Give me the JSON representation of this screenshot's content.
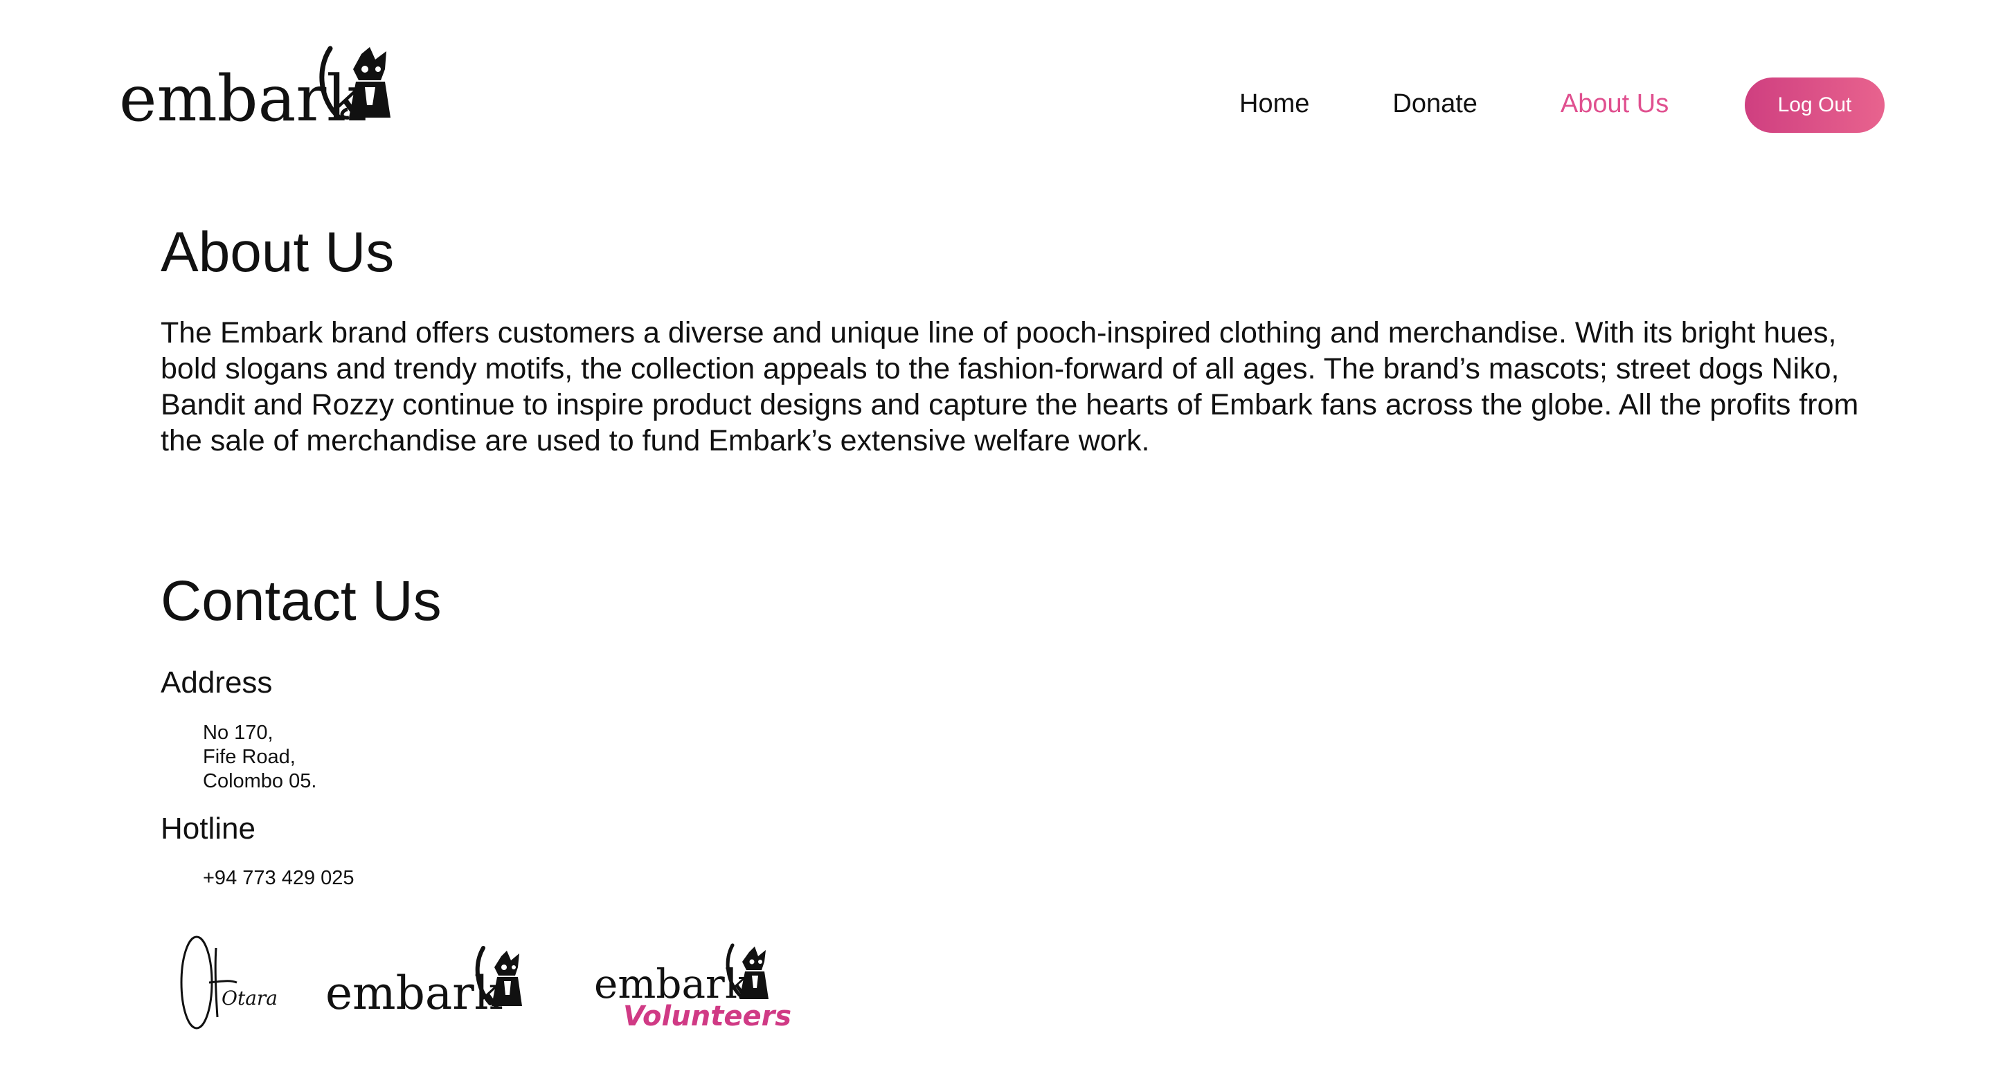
{
  "header": {
    "logo_text": "embark",
    "nav": [
      {
        "label": "Home",
        "active": false
      },
      {
        "label": "Donate",
        "active": false
      },
      {
        "label": "About Us",
        "active": true
      }
    ],
    "logout_label": "Log Out"
  },
  "about": {
    "title": "About Us",
    "text": "The Embark brand offers customers a diverse and unique line of pooch-inspired clothing and merchandise. With its bright hues, bold slogans and trendy motifs, the collection appeals to the fashion-forward of all ages. The brand’s mascots; street dogs Niko, Bandit and Rozzy continue to inspire product designs and capture the hearts of Embark fans across the globe. All the profits from the sale of merchandise are used to fund Embark’s extensive welfare work."
  },
  "contact": {
    "title": "Contact Us",
    "address_label": "Address",
    "address_lines": [
      "No 170,",
      "Fife Road,",
      "Colombo 05."
    ],
    "hotline_label": "Hotline",
    "phone": "+94 773 429 025"
  },
  "footer": {
    "signature_text": "Otara",
    "logo_text": "embark",
    "volunteers_logo_text": "embark",
    "volunteers_subtext": "Volunteers"
  },
  "colors": {
    "accent": "#e0508f",
    "button_start": "#cf3f80",
    "button_end": "#e8638e",
    "text": "#111111",
    "background": "#ffffff"
  }
}
